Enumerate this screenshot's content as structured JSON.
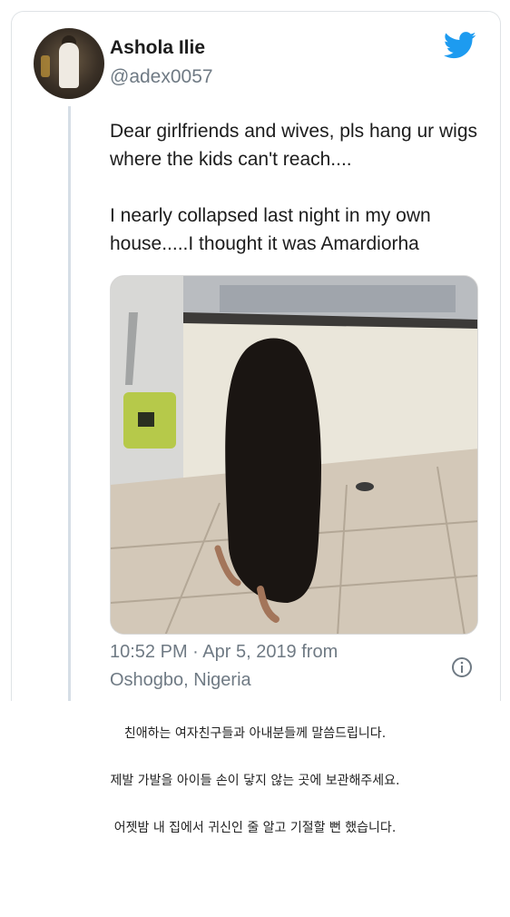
{
  "tweet": {
    "author_name": "Ashola Ilie",
    "author_handle": "@adex0057",
    "brand_color": "#1d9bf0",
    "text_paragraphs": [
      "Dear girlfriends and wives, pls hang ur wigs where the kids can't reach....",
      "I nearly collapsed last night in my own house.....I thought it was Amardiorha"
    ],
    "meta_line1": "10:52 PM · Apr 5, 2019 from",
    "meta_line2": "Oshogbo, Nigeria",
    "icons": [
      "twitter-bird-icon",
      "info-icon"
    ]
  },
  "captions": [
    "친애하는 여자친구들과 아내분들께 말씀드립니다.",
    "제발 가발을 아이들 손이 닿지 않는 곳에 보관해주세요.",
    "어젯밤 내 집에서 귀신인 줄 알고 기절할 뻔 했습니다."
  ]
}
